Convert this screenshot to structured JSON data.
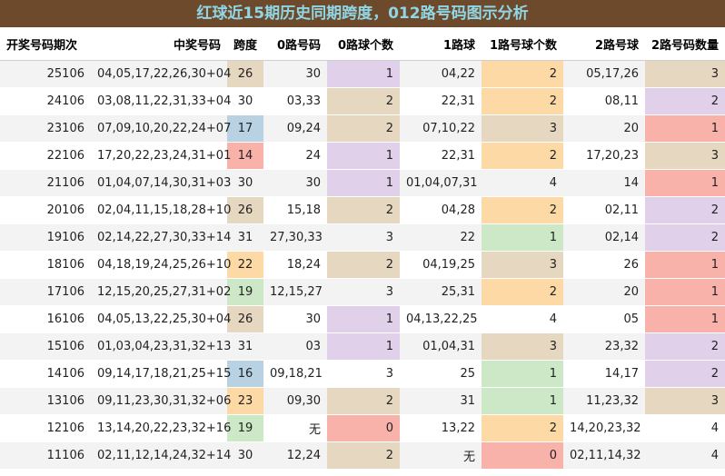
{
  "title": "红球近15期历史同期跨度，012路号码图示分析",
  "headers": [
    "开奖号码期次",
    "中奖号码",
    "跨度",
    "0路号码",
    "0路球个数",
    "1路球",
    "1路号球个数",
    "2路号球",
    "2路号码数量"
  ],
  "colors": {
    "title_bg": "#6e4a2c",
    "title_text": "#8fd7e6",
    "tan": "#e6d8c0",
    "blue": "#b8d2e4",
    "red": "#f8b2aa",
    "orange": "#fdd9a6",
    "green": "#cde8c6",
    "purple": "#e0d0ea"
  },
  "rows": [
    {
      "period": "25106",
      "numbers": "04,05,17,22,26,30+04",
      "span": "26",
      "span_c": "tan",
      "r0": "30",
      "n0": "1",
      "n0_c": "purple",
      "r1": "04,22",
      "n1": "2",
      "n1_c": "orange",
      "r2": "05,17,26",
      "n2": "3",
      "n2_c": "tan"
    },
    {
      "period": "24106",
      "numbers": "03,08,11,22,31,33+04",
      "span": "30",
      "span_c": "",
      "r0": "03,33",
      "n0": "2",
      "n0_c": "tan",
      "r1": "22,31",
      "n1": "2",
      "n1_c": "orange",
      "r2": "08,11",
      "n2": "2",
      "n2_c": "purple"
    },
    {
      "period": "23106",
      "numbers": "07,09,10,20,22,24+07",
      "span": "17",
      "span_c": "blue",
      "r0": "09,24",
      "n0": "2",
      "n0_c": "tan",
      "r1": "07,10,22",
      "n1": "3",
      "n1_c": "tan",
      "r2": "20",
      "n2": "1",
      "n2_c": "red"
    },
    {
      "period": "22106",
      "numbers": "17,20,22,23,24,31+01",
      "span": "14",
      "span_c": "red",
      "r0": "24",
      "n0": "1",
      "n0_c": "purple",
      "r1": "22,31",
      "n1": "2",
      "n1_c": "orange",
      "r2": "17,20,23",
      "n2": "3",
      "n2_c": "tan"
    },
    {
      "period": "21106",
      "numbers": "01,04,07,14,30,31+03",
      "span": "30",
      "span_c": "",
      "r0": "30",
      "n0": "1",
      "n0_c": "purple",
      "r1": "01,04,07,31",
      "n1": "4",
      "n1_c": "",
      "r2": "14",
      "n2": "1",
      "n2_c": "red"
    },
    {
      "period": "20106",
      "numbers": "02,04,11,15,18,28+10",
      "span": "26",
      "span_c": "tan",
      "r0": "15,18",
      "n0": "2",
      "n0_c": "tan",
      "r1": "04,28",
      "n1": "2",
      "n1_c": "orange",
      "r2": "02,11",
      "n2": "2",
      "n2_c": "purple"
    },
    {
      "period": "19106",
      "numbers": "02,14,22,27,30,33+14",
      "span": "31",
      "span_c": "",
      "r0": "27,30,33",
      "n0": "3",
      "n0_c": "",
      "r1": "22",
      "n1": "1",
      "n1_c": "green",
      "r2": "02,14",
      "n2": "2",
      "n2_c": "purple"
    },
    {
      "period": "18106",
      "numbers": "04,18,19,24,25,26+10",
      "span": "22",
      "span_c": "orange",
      "r0": "18,24",
      "n0": "2",
      "n0_c": "tan",
      "r1": "04,19,25",
      "n1": "3",
      "n1_c": "tan",
      "r2": "26",
      "n2": "1",
      "n2_c": "red"
    },
    {
      "period": "17106",
      "numbers": "12,15,20,25,27,31+02",
      "span": "19",
      "span_c": "green",
      "r0": "12,15,27",
      "n0": "3",
      "n0_c": "",
      "r1": "25,31",
      "n1": "2",
      "n1_c": "orange",
      "r2": "20",
      "n2": "1",
      "n2_c": "red"
    },
    {
      "period": "16106",
      "numbers": "04,05,13,22,25,30+04",
      "span": "26",
      "span_c": "tan",
      "r0": "30",
      "n0": "1",
      "n0_c": "purple",
      "r1": "04,13,22,25",
      "n1": "4",
      "n1_c": "",
      "r2": "05",
      "n2": "1",
      "n2_c": "red"
    },
    {
      "period": "15106",
      "numbers": "01,03,04,23,31,32+13",
      "span": "31",
      "span_c": "",
      "r0": "03",
      "n0": "1",
      "n0_c": "purple",
      "r1": "01,04,31",
      "n1": "3",
      "n1_c": "tan",
      "r2": "23,32",
      "n2": "2",
      "n2_c": "purple"
    },
    {
      "period": "14106",
      "numbers": "09,14,17,18,21,25+15",
      "span": "16",
      "span_c": "blue",
      "r0": "09,18,21",
      "n0": "3",
      "n0_c": "",
      "r1": "25",
      "n1": "1",
      "n1_c": "green",
      "r2": "14,17",
      "n2": "2",
      "n2_c": "purple"
    },
    {
      "period": "13106",
      "numbers": "09,11,23,30,31,32+06",
      "span": "23",
      "span_c": "orange",
      "r0": "09,30",
      "n0": "2",
      "n0_c": "tan",
      "r1": "31",
      "n1": "1",
      "n1_c": "green",
      "r2": "11,23,32",
      "n2": "3",
      "n2_c": "tan"
    },
    {
      "period": "12106",
      "numbers": "13,14,20,22,23,32+16",
      "span": "19",
      "span_c": "green",
      "r0": "无",
      "n0": "0",
      "n0_c": "red",
      "r1": "13,22",
      "n1": "2",
      "n1_c": "orange",
      "r2": "14,20,23,32",
      "n2": "4",
      "n2_c": ""
    },
    {
      "period": "11106",
      "numbers": "02,11,12,14,24,32+14",
      "span": "30",
      "span_c": "",
      "r0": "12,24",
      "n0": "2",
      "n0_c": "tan",
      "r1": "无",
      "n1": "0",
      "n1_c": "red",
      "r2": "02,11,14,32",
      "n2": "4",
      "n2_c": ""
    }
  ]
}
